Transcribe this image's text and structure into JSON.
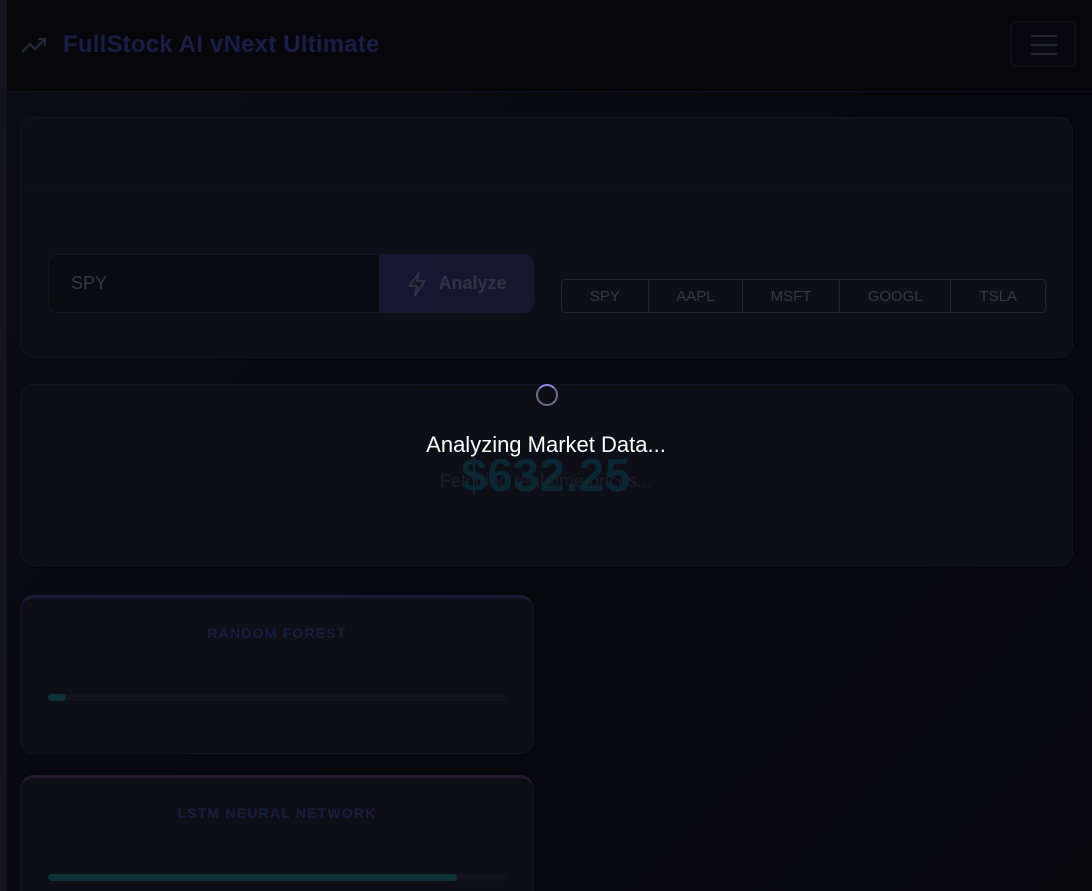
{
  "header": {
    "title": "FullStock AI vNext Ultimate",
    "brand_icon": "trending-up-icon",
    "menu_icon": "hamburger-menu-icon"
  },
  "search": {
    "input_value": "SPY",
    "analyze_label": "Analyze",
    "analyze_icon": "lightning-bolt-icon",
    "quick_tickers": [
      "SPY",
      "AAPL",
      "MSFT",
      "GOOGL",
      "TSLA"
    ]
  },
  "price": {
    "value": "$632.25",
    "status": "Fetching real-time prices..."
  },
  "models": [
    {
      "name": "RANDOM FOREST",
      "progress": 0.04
    },
    {
      "name": "LSTM NEURAL NETWORK",
      "progress": 0.89
    }
  ],
  "overlay": {
    "message": "Analyzing Market Data...",
    "spinner_icon": "loading-spinner-icon"
  },
  "colors": {
    "background": "#06060b",
    "brand_title": "#1e2150",
    "price": "#0e2d3c",
    "progress_fill": "#0f3a3f",
    "overlay_text": "#ffffff"
  }
}
